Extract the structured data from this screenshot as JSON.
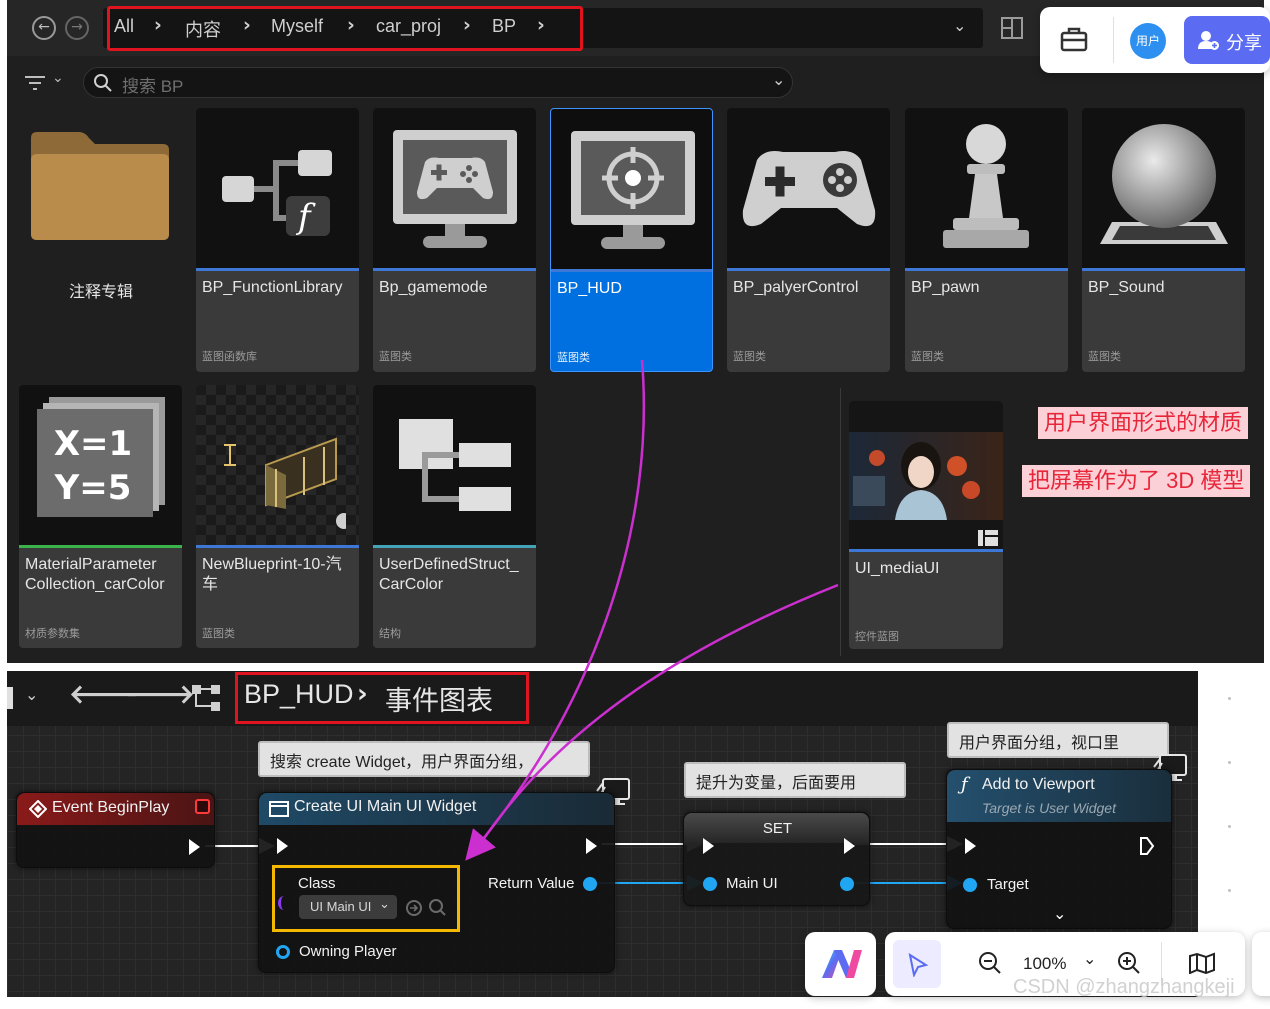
{
  "breadcrumb": [
    "All",
    "内容",
    "Myself",
    "car_proj",
    "BP"
  ],
  "search": {
    "placeholder": "搜索 BP"
  },
  "float_widget": {
    "avatar_label": "用户",
    "share_label": "分享"
  },
  "assets_row1": [
    {
      "name": "注释专辑",
      "type": "",
      "kind": "folder"
    },
    {
      "name": "BP_FunctionLibrary",
      "type": "蓝图函数库",
      "kind": "function-library"
    },
    {
      "name": "Bp_gamemode",
      "type": "蓝图类",
      "kind": "gamemode"
    },
    {
      "name": "BP_HUD",
      "type": "蓝图类",
      "kind": "hud",
      "selected": true
    },
    {
      "name": "BP_palyerControl",
      "type": "蓝图类",
      "kind": "player-controller"
    },
    {
      "name": "BP_pawn",
      "type": "蓝图类",
      "kind": "pawn"
    },
    {
      "name": "BP_Sound",
      "type": "蓝图类",
      "kind": "sound"
    }
  ],
  "assets_row2": [
    {
      "name": "MaterialParameter Collection_carColor",
      "type": "材质参数集",
      "kind": "material-parameter-collection",
      "thumb_text": [
        "X=1",
        "Y=5"
      ]
    },
    {
      "name": "NewBlueprint-10-汽车",
      "type": "蓝图类",
      "kind": "blueprint-actor"
    },
    {
      "name": "UserDefinedStruct_ CarColor",
      "type": "结构",
      "kind": "struct"
    },
    {
      "name": "UI_mediaUI",
      "type": "控件蓝图",
      "kind": "widget-blueprint"
    }
  ],
  "annotations": {
    "note1": "用户界面形式的材质",
    "note2": "把屏幕作为了 3D 模型"
  },
  "graph": {
    "title": "BP_HUD",
    "subtitle": "事件图表",
    "comments": {
      "create_widget": "搜索 create Widget，用户界面分组，",
      "set_var": "提升为变量，后面要用",
      "add_viewport": "用户界面分组，视口里"
    },
    "nodes": {
      "begin_play": {
        "title": "Event BeginPlay"
      },
      "create_widget": {
        "title": "Create UI Main UI Widget",
        "class_label": "Class",
        "class_value": "UI Main UI",
        "return_label": "Return Value",
        "owner_label": "Owning Player"
      },
      "set": {
        "title": "SET",
        "var_label": "Main UI"
      },
      "add_viewport": {
        "title": "Add to Viewport",
        "subtitle": "Target is User Widget",
        "target_label": "Target"
      }
    }
  },
  "bottom_toolbar": {
    "zoom": "100%"
  },
  "watermark": "CSDN @zhangzhangkeji",
  "colors": {
    "selected": "#0070e0",
    "annotation_red": "#e0141e",
    "class_highlight": "#f5b800",
    "magenta_arrow": "#cc2fcf",
    "exec_wire": "#ffffff",
    "data_wire": "#21a6f3"
  }
}
